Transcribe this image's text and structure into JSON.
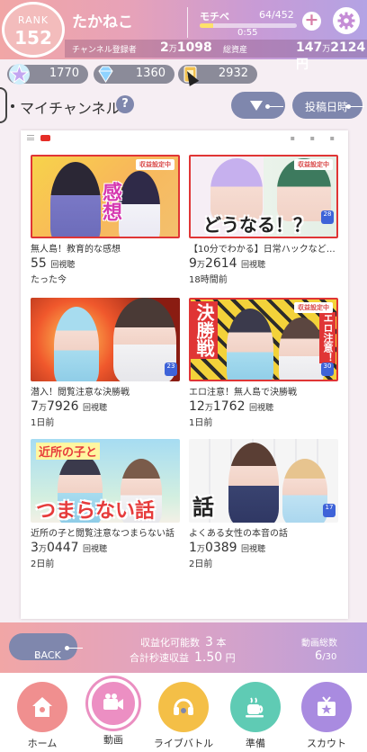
{
  "header": {
    "rank_label": "RANK",
    "rank_value": "152",
    "user_name": "たかねこ",
    "subscribers_label": "チャンネル登録者",
    "subscribers_main": "2",
    "subscribers_unit": "万",
    "subscribers_rest": "1098",
    "assets_label": "総資産",
    "assets_main": "147",
    "assets_unit": "万",
    "assets_rest": "2124円",
    "motivation_label": "モチベ",
    "motivation_count": "64/452",
    "motivation_fraction": 0.14,
    "motivation_timer": "0:55",
    "plus_symbol": "+",
    "plus_icon": "plus-icon",
    "settings_icon": "gear-icon"
  },
  "currencies": [
    {
      "icon": "star-icon",
      "value": "1770",
      "color": "#9ad7f0"
    },
    {
      "icon": "diamond-icon",
      "value": "1360",
      "color": "#8fd3ff"
    },
    {
      "icon": "ticket-icon",
      "value": "2932",
      "color": "#f2c14e"
    }
  ],
  "channel": {
    "title": "マイチャンネル",
    "help_symbol": "?",
    "sort_label": "投稿日時"
  },
  "videos": [
    {
      "title": "無人島！教育的な感想",
      "views_main": "55",
      "views_unit": "",
      "views_rest": "",
      "views_suffix": "回視聴",
      "time": "たった今",
      "badge": "収益設定中",
      "thumb_text": "感想",
      "count": ""
    },
    {
      "title": "【10分でわかる】日常ハックなど…",
      "views_main": "9",
      "views_unit": "万",
      "views_rest": "2614",
      "views_suffix": "回視聴",
      "time": "18時間前",
      "badge": "収益設定中",
      "thumb_text": "どうなる！？",
      "count": "28"
    },
    {
      "title": "潜入！閲覧注意な決勝戦",
      "views_main": "7",
      "views_unit": "万",
      "views_rest": "7926",
      "views_suffix": "回視聴",
      "time": "1日前",
      "badge": "",
      "thumb_text": "",
      "count": "23"
    },
    {
      "title": "エロ注意！無人島で決勝戦",
      "views_main": "12",
      "views_unit": "万",
      "views_rest": "1762",
      "views_suffix": "回視聴",
      "time": "1日前",
      "badge": "収益設定中",
      "thumb_text": "決勝戦",
      "thumb_text2": "エロ注意！",
      "count": "30"
    },
    {
      "title": "近所の子と閲覧注意なつまらない話",
      "views_main": "3",
      "views_unit": "万",
      "views_rest": "0447",
      "views_suffix": "回視聴",
      "time": "2日前",
      "badge": "",
      "thumb_text": "つまらない話",
      "thumb_text2": "近所の子と",
      "count": ""
    },
    {
      "title": "よくある女性の本音の話",
      "views_main": "1",
      "views_unit": "万",
      "views_rest": "0389",
      "views_suffix": "回視聴",
      "time": "2日前",
      "badge": "",
      "thumb_text": "話",
      "count": "17"
    }
  ],
  "footer_info": {
    "back_label": "BACK",
    "monetizable_label": "収益化可能数",
    "monetizable_value": "3",
    "monetizable_unit": "本",
    "per_second_label": "合計秒速収益",
    "per_second_value": "1.50",
    "per_second_unit": "円",
    "total_label": "動画総数",
    "total_value": "6",
    "total_max": "/30"
  },
  "nav": [
    {
      "label": "ホーム",
      "icon": "home-icon",
      "color": "#f08f8f",
      "active": false
    },
    {
      "label": "動画",
      "icon": "video-camera-icon",
      "color": "#ec8fc3",
      "active": true
    },
    {
      "label": "ライブバトル",
      "icon": "headset-icon",
      "color": "#f4bf47",
      "active": false
    },
    {
      "label": "準備",
      "icon": "coffee-cup-icon",
      "color": "#5fcbb4",
      "active": false
    },
    {
      "label": "スカウト",
      "icon": "tv-icon",
      "color": "#a98be0",
      "active": false
    }
  ]
}
